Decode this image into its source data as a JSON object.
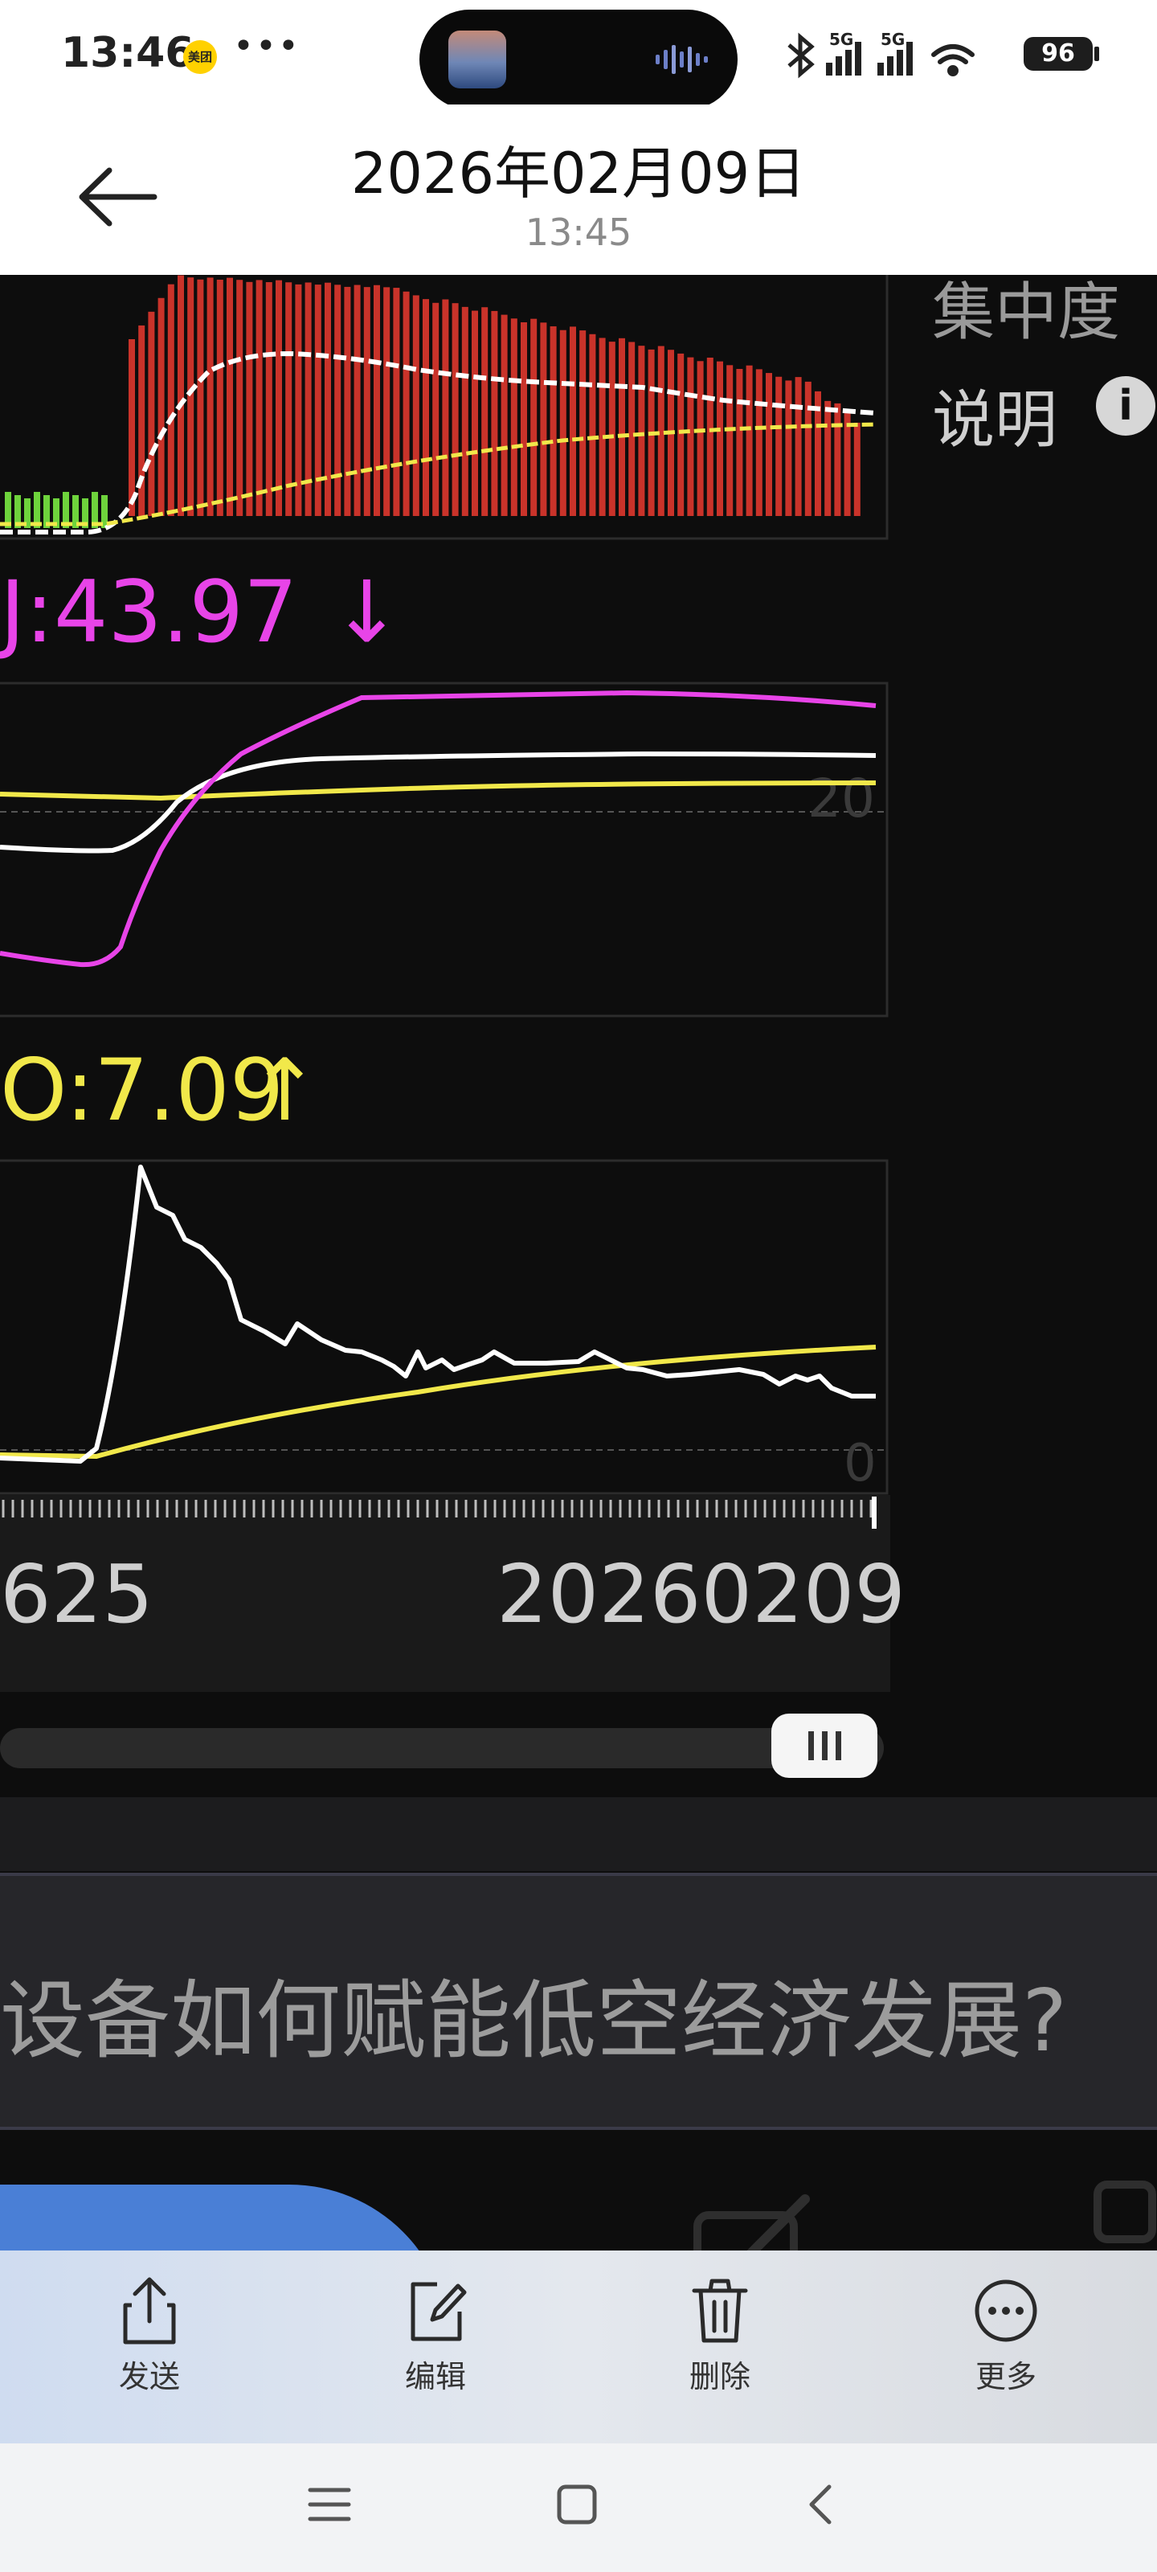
{
  "status_bar": {
    "time": "13:46",
    "app_badge": "美团",
    "more_dots": "•••",
    "battery": "96",
    "network_1": "5G",
    "network_2": "5G"
  },
  "header": {
    "date": "2026年02月09日",
    "time": "13:45"
  },
  "chart": {
    "side_labels": [
      "集中度",
      "说明"
    ],
    "info_glyph": "i",
    "j_indicator": "J:43.97",
    "j_arrow": "↓",
    "o_indicator": "O:7.09",
    "o_arrow": "↑",
    "ref_level_j": "20",
    "ref_level_o": "0",
    "date_start": "625",
    "date_end": "20260209"
  },
  "question": {
    "text": "设备如何赋能低空经济发展?"
  },
  "toolbar": {
    "items": [
      {
        "label": "发送",
        "icon": "share-icon"
      },
      {
        "label": "编辑",
        "icon": "edit-icon"
      },
      {
        "label": "删除",
        "icon": "trash-icon"
      },
      {
        "label": "更多",
        "icon": "more-icon"
      }
    ]
  },
  "colors": {
    "magenta": "#e844e8",
    "yellow": "#f1e84a",
    "bar_red": "#c9332a",
    "bar_green": "#6ed33c",
    "accent_blue": "#4a7fd6"
  }
}
